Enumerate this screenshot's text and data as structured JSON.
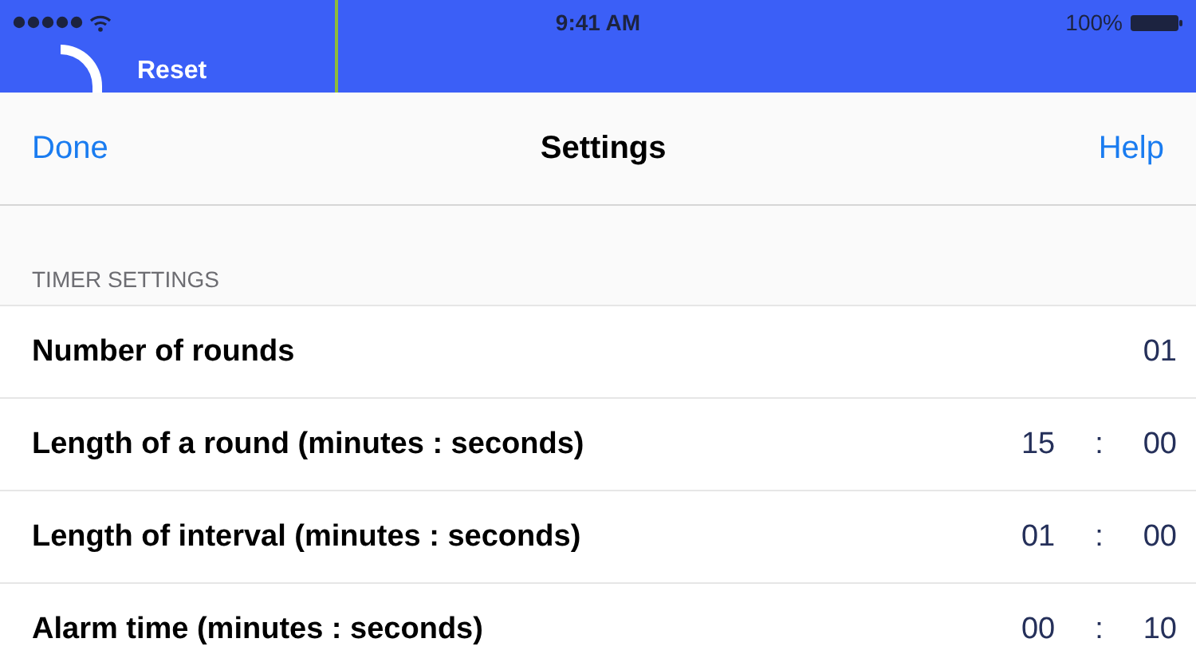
{
  "status_bar": {
    "time": "9:41 AM",
    "battery": "100%"
  },
  "background": {
    "button": "Reset"
  },
  "nav": {
    "left": "Done",
    "title": "Settings",
    "right": "Help"
  },
  "section": {
    "header": "TIMER SETTINGS"
  },
  "rows": [
    {
      "kind": "single",
      "label": "Number of rounds",
      "value": "01"
    },
    {
      "kind": "time",
      "label": "Length of a round (minutes : seconds)",
      "minutes": "15",
      "separator": ":",
      "seconds": "00"
    },
    {
      "kind": "time",
      "label": "Length of interval (minutes : seconds)",
      "minutes": "01",
      "separator": ":",
      "seconds": "00"
    },
    {
      "kind": "time",
      "label": "Alarm time (minutes : seconds)",
      "minutes": "00",
      "separator": ":",
      "seconds": "10"
    }
  ]
}
